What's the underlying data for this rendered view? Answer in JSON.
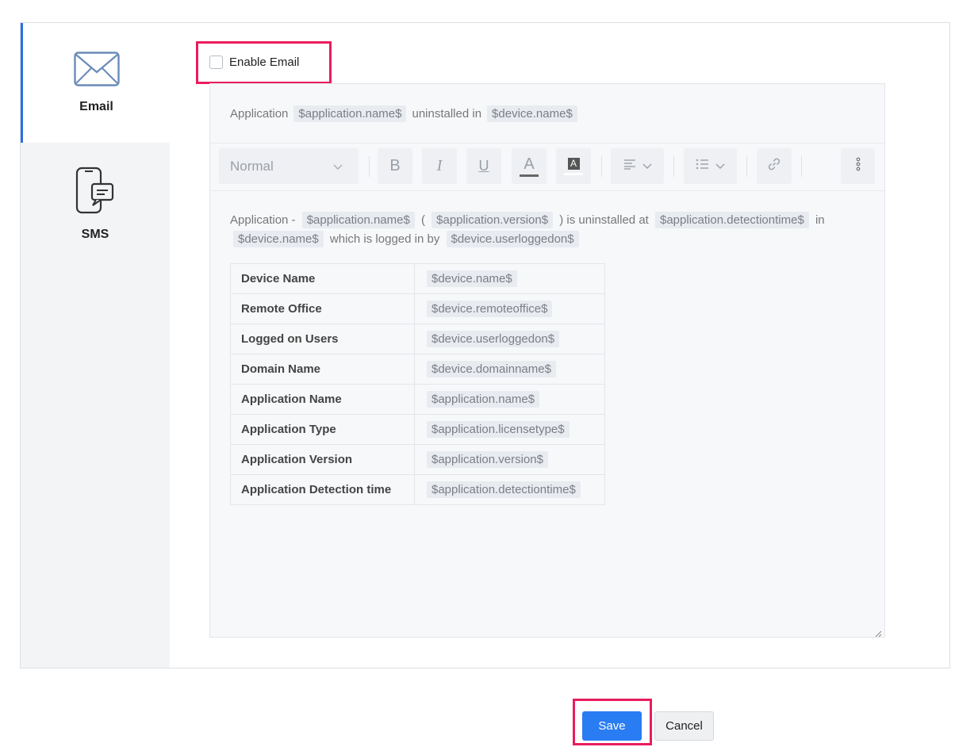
{
  "sidebar": {
    "tabs": [
      {
        "label": "Email",
        "icon": "envelope-icon",
        "active": true
      },
      {
        "label": "SMS",
        "icon": "phone-message-icon",
        "active": false
      }
    ]
  },
  "enable_email": {
    "label": "Enable Email",
    "checked": false
  },
  "editor": {
    "subject": {
      "text1": "Application",
      "var1": "$application.name$",
      "text2": "uninstalled in",
      "var2": "$device.name$"
    },
    "toolbar": {
      "format_value": "Normal",
      "bold_glyph": "B",
      "italic_glyph": "I",
      "underline_glyph": "U",
      "font_color_glyph": "A",
      "bg_color_glyph": "A"
    },
    "body": {
      "t1": "Application -",
      "v1": "$application.name$",
      "t2": "(",
      "v2": "$application.version$",
      "t3": ") is uninstalled at",
      "v3": "$application.detectiontime$",
      "t4": "in",
      "v4": "$device.name$",
      "t5": "which is logged in by",
      "v5": "$device.userloggedon$"
    },
    "table": [
      {
        "label": "Device Name",
        "value": "$device.name$"
      },
      {
        "label": "Remote Office",
        "value": "$device.remoteoffice$"
      },
      {
        "label": "Logged on Users",
        "value": "$device.userloggedon$"
      },
      {
        "label": "Domain Name",
        "value": "$device.domainname$"
      },
      {
        "label": "Application Name",
        "value": "$application.name$"
      },
      {
        "label": "Application Type",
        "value": "$application.licensetype$"
      },
      {
        "label": "Application Version",
        "value": "$application.version$"
      },
      {
        "label": "Application Detection time",
        "value": "$application.detectiontime$"
      }
    ]
  },
  "actions": {
    "save": "Save",
    "cancel": "Cancel"
  },
  "colors": {
    "accent": "#2a7cf2",
    "highlight": "#ea1c5d",
    "active_tab_border": "#2a6ee6"
  }
}
